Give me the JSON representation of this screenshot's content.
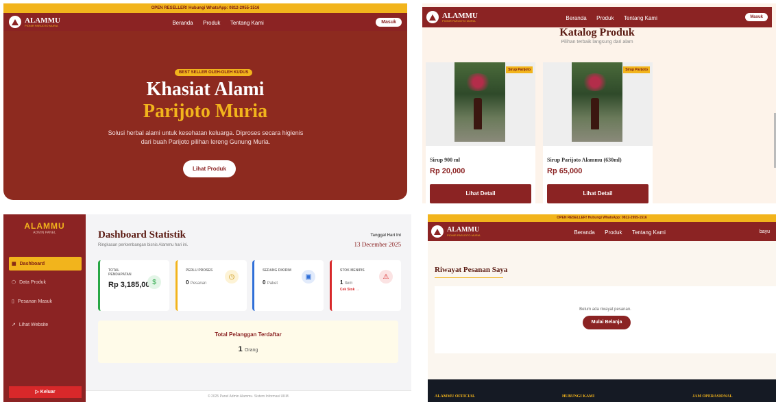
{
  "hero": {
    "topbar": "OPEN RESELLER! Hubungi WhatsApp: 0812-2955-1516",
    "brand": "ALAMMU",
    "brand_sub": "PIONIR PARIJOTO MURIA",
    "nav": [
      "Beranda",
      "Produk",
      "Tentang Kami"
    ],
    "login": "Masuk",
    "badge": "BEST SELLER OLEH-OLEH KUDUS",
    "headline_1": "Khasiat Alami",
    "headline_2": "Parijoto Muria",
    "description": "Solusi herbal alami untuk kesehatan keluarga. Diproses secara higienis dari buah Parijoto pilihan lereng Gunung Muria.",
    "cta": "Lihat Produk"
  },
  "catalog": {
    "brand": "ALAMMU",
    "brand_sub": "PIONIR PARIJOTO MURIA",
    "nav": [
      "Beranda",
      "Produk",
      "Tentang Kami"
    ],
    "login": "Masuk",
    "title": "Katalog Produk",
    "subtitle": "Pilihan terbaik langsung dari alam",
    "products": [
      {
        "tag": "Sirup Parijoto",
        "name": "Sirup 900 ml",
        "price": "Rp 20,000",
        "button": "Lihat Detail"
      },
      {
        "tag": "Sirup Parijoto",
        "name": "Sirup Parijoto Alammu (630ml)",
        "price": "Rp 65,000",
        "button": "Lihat Detail"
      }
    ]
  },
  "dashboard": {
    "brand": "ALAMMU",
    "brand_sub": "ADMIN PANEL",
    "menu": [
      "Dashboard",
      "Data Produk",
      "Pesanan Masuk",
      "Lihat Website"
    ],
    "logout": "Keluar",
    "title": "Dashboard Statistik",
    "subtitle": "Ringkasan perkembangan bisnis Alammu hari ini.",
    "date_label": "Tanggal Hari Ini",
    "date_value": "13 December 2025",
    "stats": [
      {
        "label": "TOTAL PENDAPATAN",
        "value": "Rp 3,185,000",
        "unit": "",
        "note": "",
        "color": "#28a745",
        "icon": "dollar-icon"
      },
      {
        "label": "PERLU PROSES",
        "value": "0",
        "unit": "Pesanan",
        "note": "",
        "color": "#f2b41c",
        "icon": "clock-icon"
      },
      {
        "label": "SEDANG DIKIRIM",
        "value": "0",
        "unit": "Paket",
        "note": "",
        "color": "#2f6fd8",
        "icon": "box-icon"
      },
      {
        "label": "STOK MENIPIS",
        "value": "1",
        "unit": "Item",
        "note": "Cek Stok →",
        "color": "#d8282a",
        "icon": "warning-icon"
      }
    ],
    "total_label": "Total Pelanggan Terdaftar",
    "total_value": "1",
    "total_unit": "Orang",
    "footer": "© 2025 Panel Admin Alammu. Sistem Informasi UKM."
  },
  "riwayat": {
    "topbar": "OPEN RESELLER! Hubungi WhatsApp: 0812-2955-1516",
    "brand": "ALAMMU",
    "brand_sub": "PIONIR PARIJOTO MURIA",
    "nav": [
      "Beranda",
      "Produk",
      "Tentang Kami"
    ],
    "user": "bayu",
    "title": "Riwayat Pesanan Saya",
    "empty": "Belum ada riwayat pesanan.",
    "button": "Mulai Belanja",
    "footer_cols": [
      "ALAMMU OFFICIAL",
      "HUBUNGI KAMI",
      "JAM OPERASIONAL"
    ]
  }
}
